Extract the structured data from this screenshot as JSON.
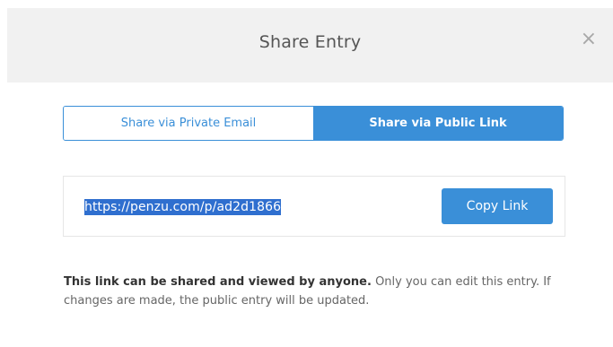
{
  "dialog": {
    "title": "Share Entry",
    "close_glyph": "×"
  },
  "toggle": {
    "private_label": "Share via Private Email",
    "public_label": "Share via Public Link",
    "selected": "public"
  },
  "link": {
    "url": "https://penzu.com/p/ad2d1866",
    "copy_label": "Copy Link"
  },
  "info": {
    "bold_text": "This link can be shared and viewed by anyone.",
    "rest_text": " Only you can edit this entry. If changes are made, the public entry will be updated."
  },
  "colors": {
    "accent": "#3a8fd8",
    "header_bg": "#f1f1f1",
    "selection": "#2f6fcf"
  }
}
